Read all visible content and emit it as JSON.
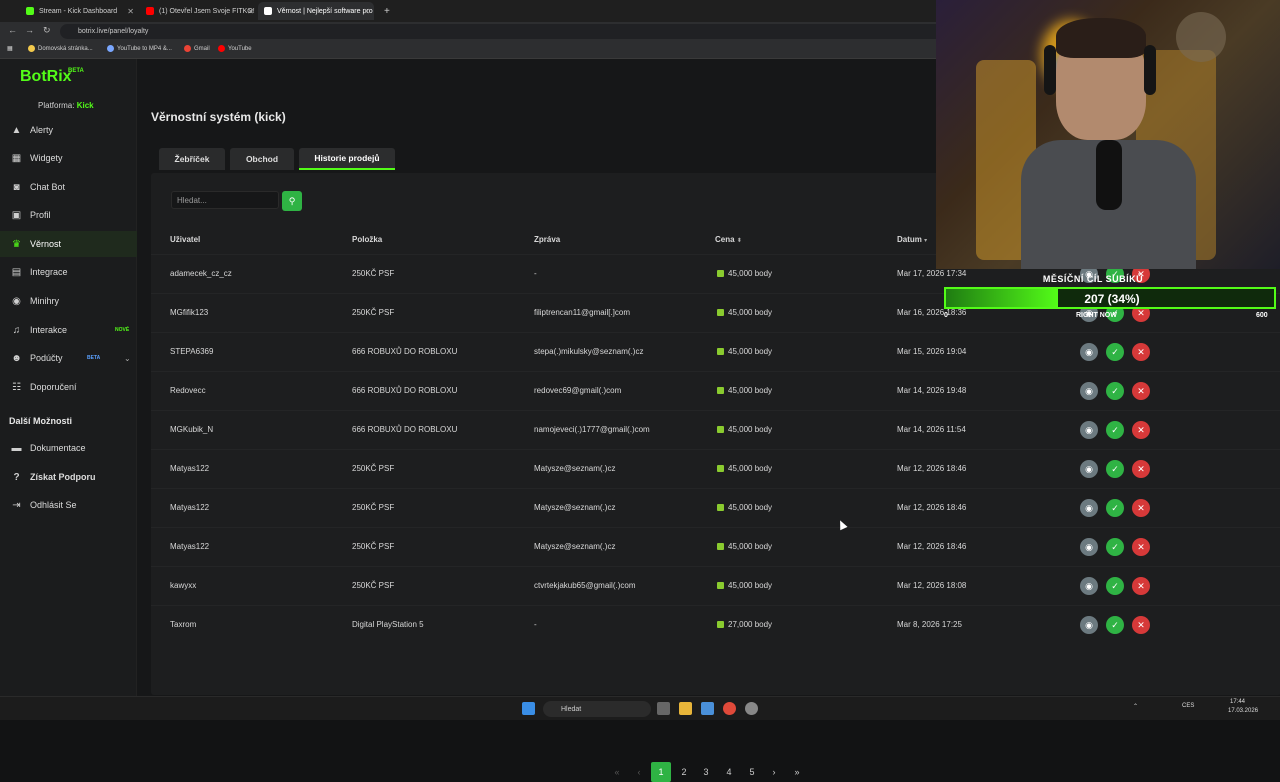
{
  "browser": {
    "tabs": [
      {
        "title": "Stream - Kick Dashboard",
        "color": "#53fc18"
      },
      {
        "title": "(1) Otevřel Jsem Svoje FITKO!",
        "color": "#ff0000"
      },
      {
        "title": "Věrnost | Nejlepší software pro",
        "color": "#ffffff"
      }
    ],
    "url": "botrix.live/panel/loyalty",
    "bookmarks": [
      "Domovská stránka...",
      "YouTube to MP4 &...",
      "Gmail",
      "YouTube"
    ]
  },
  "sidebar": {
    "logo": "BotRix",
    "logo_sup": "BETA",
    "platform_label": "Platforma:",
    "platform_value": "Kick",
    "items": [
      {
        "label": "Alerty",
        "icon": "warning-icon"
      },
      {
        "label": "Widgety",
        "icon": "grid-icon"
      },
      {
        "label": "Chat Bot",
        "icon": "robot-icon"
      },
      {
        "label": "Profil",
        "icon": "id-card-icon"
      },
      {
        "label": "Věrnost",
        "icon": "trophy-icon"
      },
      {
        "label": "Integrace",
        "icon": "integration-icon"
      },
      {
        "label": "Minihry",
        "icon": "gamepad-icon"
      },
      {
        "label": "Interakce",
        "icon": "music-icon",
        "badge": "NOVÉ"
      },
      {
        "label": "Podúčty",
        "icon": "users-icon",
        "badge": "BETA"
      },
      {
        "label": "Doporučení",
        "icon": "referral-icon"
      }
    ],
    "section_title": "Další Možnosti",
    "more": [
      {
        "label": "Dokumentace",
        "icon": "book-icon"
      },
      {
        "label": "Získat Podporu",
        "icon": "question-icon"
      },
      {
        "label": "Odhlásit Se",
        "icon": "logout-icon"
      }
    ]
  },
  "main": {
    "title": "Věrnostní systém (kick)",
    "tabs": [
      "Žebříček",
      "Obchod",
      "Historie prodejů"
    ],
    "search_placeholder": "Hledat...",
    "columns": [
      "Uživatel",
      "Položka",
      "Zpráva",
      "Cena",
      "Datum"
    ],
    "rows": [
      {
        "user": "adamecek_cz_cz",
        "item": "250KČ PSF",
        "msg": "-",
        "price": "45,000 body",
        "date": "Mar 17, 2026 17:34"
      },
      {
        "user": "MGfifik123",
        "item": "250KČ PSF",
        "msg": "filiptrencan11@gmail[.]com",
        "price": "45,000 body",
        "date": "Mar 16, 2026 18:36"
      },
      {
        "user": "STEPA6369",
        "item": "666 ROBUXŮ DO ROBLOXU",
        "msg": "stepa(.)mikulsky@seznam(.)cz",
        "price": "45,000 body",
        "date": "Mar 15, 2026 19:04"
      },
      {
        "user": "Redovecc",
        "item": "666 ROBUXŮ DO ROBLOXU",
        "msg": "redovec69@gmail(.)com",
        "price": "45,000 body",
        "date": "Mar 14, 2026 19:48"
      },
      {
        "user": "MGKubik_N",
        "item": "666 ROBUXŮ DO ROBLOXU",
        "msg": "namojeveci(.)1777@gmail(.)com",
        "price": "45,000 body",
        "date": "Mar 14, 2026 11:54"
      },
      {
        "user": "Matyas122",
        "item": "250KČ PSF",
        "msg": "Matysze@seznam(.)cz",
        "price": "45,000 body",
        "date": "Mar 12, 2026 18:46"
      },
      {
        "user": "Matyas122",
        "item": "250KČ PSF",
        "msg": "Matysze@seznam(.)cz",
        "price": "45,000 body",
        "date": "Mar 12, 2026 18:46"
      },
      {
        "user": "Matyas122",
        "item": "250KČ PSF",
        "msg": "Matysze@seznam(.)cz",
        "price": "45,000 body",
        "date": "Mar 12, 2026 18:46"
      },
      {
        "user": "kawyxx",
        "item": "250KČ PSF",
        "msg": "ctvrtekjakub65@gmail(.)com",
        "price": "45,000 body",
        "date": "Mar 12, 2026 18:08"
      },
      {
        "user": "Taxrom",
        "item": "Digital PlayStation 5",
        "msg": "-",
        "price": "27,000 body",
        "date": "Mar 8, 2026 17:25"
      }
    ],
    "pages": [
      "1",
      "2",
      "3",
      "4",
      "5"
    ],
    "current_page": "1"
  },
  "overlay": {
    "goal_title": "MĚSÍČNÍ CÍL SUBÍKŮ",
    "goal_value": "207 (34%)",
    "goal_fraction": 0.34,
    "min": "0",
    "max": "600",
    "sub": "RIGHT NOW"
  },
  "taskbar": {
    "search": "Hledat",
    "lang": "CES",
    "time": "17:44",
    "date": "17.03.2026"
  },
  "colors": {
    "accent": "#53fc18",
    "button_green": "#2fb344",
    "danger": "#d63939"
  }
}
